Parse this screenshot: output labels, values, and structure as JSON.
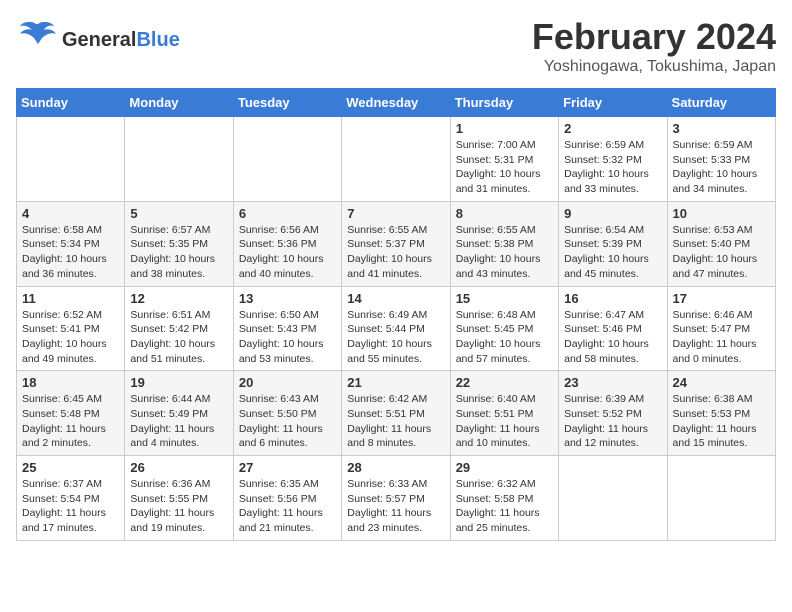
{
  "header": {
    "logo_general": "General",
    "logo_blue": "Blue",
    "month_title": "February 2024",
    "location": "Yoshinogawa, Tokushima, Japan"
  },
  "weekdays": [
    "Sunday",
    "Monday",
    "Tuesday",
    "Wednesday",
    "Thursday",
    "Friday",
    "Saturday"
  ],
  "weeks": [
    [
      {
        "day": "",
        "info": ""
      },
      {
        "day": "",
        "info": ""
      },
      {
        "day": "",
        "info": ""
      },
      {
        "day": "",
        "info": ""
      },
      {
        "day": "1",
        "info": "Sunrise: 7:00 AM\nSunset: 5:31 PM\nDaylight: 10 hours\nand 31 minutes."
      },
      {
        "day": "2",
        "info": "Sunrise: 6:59 AM\nSunset: 5:32 PM\nDaylight: 10 hours\nand 33 minutes."
      },
      {
        "day": "3",
        "info": "Sunrise: 6:59 AM\nSunset: 5:33 PM\nDaylight: 10 hours\nand 34 minutes."
      }
    ],
    [
      {
        "day": "4",
        "info": "Sunrise: 6:58 AM\nSunset: 5:34 PM\nDaylight: 10 hours\nand 36 minutes."
      },
      {
        "day": "5",
        "info": "Sunrise: 6:57 AM\nSunset: 5:35 PM\nDaylight: 10 hours\nand 38 minutes."
      },
      {
        "day": "6",
        "info": "Sunrise: 6:56 AM\nSunset: 5:36 PM\nDaylight: 10 hours\nand 40 minutes."
      },
      {
        "day": "7",
        "info": "Sunrise: 6:55 AM\nSunset: 5:37 PM\nDaylight: 10 hours\nand 41 minutes."
      },
      {
        "day": "8",
        "info": "Sunrise: 6:55 AM\nSunset: 5:38 PM\nDaylight: 10 hours\nand 43 minutes."
      },
      {
        "day": "9",
        "info": "Sunrise: 6:54 AM\nSunset: 5:39 PM\nDaylight: 10 hours\nand 45 minutes."
      },
      {
        "day": "10",
        "info": "Sunrise: 6:53 AM\nSunset: 5:40 PM\nDaylight: 10 hours\nand 47 minutes."
      }
    ],
    [
      {
        "day": "11",
        "info": "Sunrise: 6:52 AM\nSunset: 5:41 PM\nDaylight: 10 hours\nand 49 minutes."
      },
      {
        "day": "12",
        "info": "Sunrise: 6:51 AM\nSunset: 5:42 PM\nDaylight: 10 hours\nand 51 minutes."
      },
      {
        "day": "13",
        "info": "Sunrise: 6:50 AM\nSunset: 5:43 PM\nDaylight: 10 hours\nand 53 minutes."
      },
      {
        "day": "14",
        "info": "Sunrise: 6:49 AM\nSunset: 5:44 PM\nDaylight: 10 hours\nand 55 minutes."
      },
      {
        "day": "15",
        "info": "Sunrise: 6:48 AM\nSunset: 5:45 PM\nDaylight: 10 hours\nand 57 minutes."
      },
      {
        "day": "16",
        "info": "Sunrise: 6:47 AM\nSunset: 5:46 PM\nDaylight: 10 hours\nand 58 minutes."
      },
      {
        "day": "17",
        "info": "Sunrise: 6:46 AM\nSunset: 5:47 PM\nDaylight: 11 hours\nand 0 minutes."
      }
    ],
    [
      {
        "day": "18",
        "info": "Sunrise: 6:45 AM\nSunset: 5:48 PM\nDaylight: 11 hours\nand 2 minutes."
      },
      {
        "day": "19",
        "info": "Sunrise: 6:44 AM\nSunset: 5:49 PM\nDaylight: 11 hours\nand 4 minutes."
      },
      {
        "day": "20",
        "info": "Sunrise: 6:43 AM\nSunset: 5:50 PM\nDaylight: 11 hours\nand 6 minutes."
      },
      {
        "day": "21",
        "info": "Sunrise: 6:42 AM\nSunset: 5:51 PM\nDaylight: 11 hours\nand 8 minutes."
      },
      {
        "day": "22",
        "info": "Sunrise: 6:40 AM\nSunset: 5:51 PM\nDaylight: 11 hours\nand 10 minutes."
      },
      {
        "day": "23",
        "info": "Sunrise: 6:39 AM\nSunset: 5:52 PM\nDaylight: 11 hours\nand 12 minutes."
      },
      {
        "day": "24",
        "info": "Sunrise: 6:38 AM\nSunset: 5:53 PM\nDaylight: 11 hours\nand 15 minutes."
      }
    ],
    [
      {
        "day": "25",
        "info": "Sunrise: 6:37 AM\nSunset: 5:54 PM\nDaylight: 11 hours\nand 17 minutes."
      },
      {
        "day": "26",
        "info": "Sunrise: 6:36 AM\nSunset: 5:55 PM\nDaylight: 11 hours\nand 19 minutes."
      },
      {
        "day": "27",
        "info": "Sunrise: 6:35 AM\nSunset: 5:56 PM\nDaylight: 11 hours\nand 21 minutes."
      },
      {
        "day": "28",
        "info": "Sunrise: 6:33 AM\nSunset: 5:57 PM\nDaylight: 11 hours\nand 23 minutes."
      },
      {
        "day": "29",
        "info": "Sunrise: 6:32 AM\nSunset: 5:58 PM\nDaylight: 11 hours\nand 25 minutes."
      },
      {
        "day": "",
        "info": ""
      },
      {
        "day": "",
        "info": ""
      }
    ]
  ]
}
